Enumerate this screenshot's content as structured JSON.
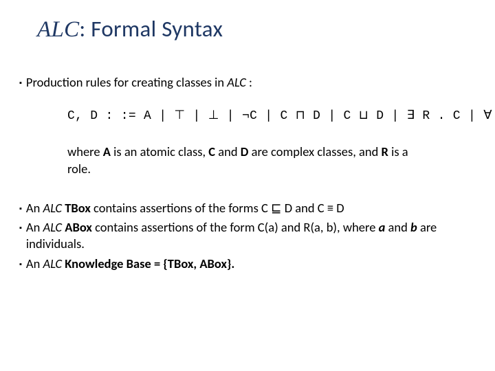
{
  "title": {
    "alc": "ALC",
    "suffix": ": Formal Syntax"
  },
  "intro": {
    "prefix": "Production rules for creating classes in ",
    "alc": "ALC",
    "suffix": " :"
  },
  "grammar": "C, D : := A  | ⊤ | ⊥ |  ¬C | C ⊓ D | C ⊔ D | ∃ R . C | ∀ R . C",
  "where": {
    "p1": "where ",
    "A": "A",
    "p2": " is an atomic class, ",
    "C": "C",
    "p3": " and ",
    "D": "D",
    "p4": " are complex classes, and ",
    "R": "R",
    "p5": " is a role."
  },
  "bullets": {
    "b1": {
      "p1": "An ",
      "alc": "ALC",
      "tbox": " TBox",
      "p2": "  contains assertions of the forms C ⊑ D and C ≡ D"
    },
    "b2": {
      "p1": "An ",
      "alc": "ALC",
      "abox": " ABox",
      "p2": "  contains assertions of the form C(a) and R(a, b), where ",
      "a": "a",
      "p3": " and ",
      "b": "b",
      "p4": " are individuals."
    },
    "b3": {
      "p1": "An ",
      "alc": "ALC",
      "kb": " Knowledge Base = {TBox, ABox}."
    }
  }
}
